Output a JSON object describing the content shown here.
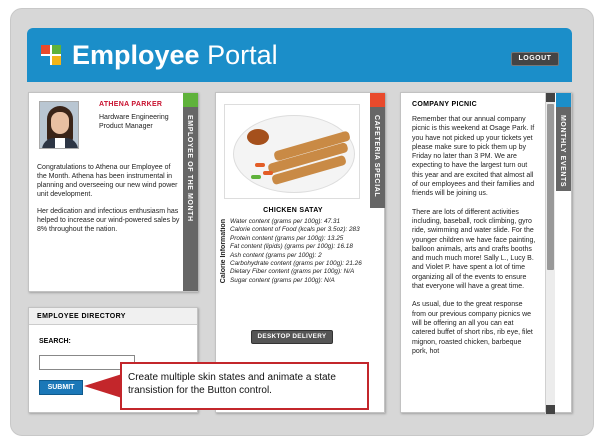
{
  "header": {
    "title_bold": "Employee",
    "title_rest": " Portal",
    "logout_label": "LOGOUT"
  },
  "employee_of_month": {
    "name": "ATHENA PARKER",
    "role": "Hardware Engineering Product Manager",
    "paragraphs": [
      "Congratulations to Athena our Employee of the Month. Athena has been instrumental in planning and overseeing our new wind power unit development.",
      "Her dedication and infectious enthusiasm has helped to increase our wind-powered sales by 8% throughout the nation."
    ],
    "tab_label": "EMPLOYEE OF THE MONTH",
    "accent": "#5fb23b"
  },
  "directory": {
    "title": "EMPLOYEE DIRECTORY",
    "search_label": "SEARCH:",
    "search_value": "",
    "submit_label": "SUBMIT"
  },
  "cafeteria": {
    "tab_label": "CAFETERIA SPECIAL",
    "accent": "#e94a2c",
    "dish_name": "CHICKEN SATAY",
    "info_label": "Calorie Information",
    "nutrition": [
      "Water content (grams per 100g): 47.31",
      "Calorie content of Food (kcals per 3.5oz): 283",
      "Protein content (grams per 100g): 13.25",
      "Fat content (lipids) (grams per 100g): 16.18",
      "Ash content (grams per 100g): 2",
      "Carbohydrate content (grams per 100g): 21.26",
      "Dietary Fiber content (grams per 100g): N/A",
      "Sugar content (grams per 100g): N/A"
    ],
    "delivery_label": "DESKTOP DELIVERY"
  },
  "events": {
    "tab_label": "MONTHLY EVENTS",
    "accent": "#1b8ec9",
    "title": "COMPANY PICNIC",
    "paragraphs": [
      "Remember that our annual company picnic is this weekend at Osage Park. If you have not picked up your tickets yet please make sure to pick them up by Friday no later than 3 PM. We are expecting to have the largest turn out this year and are excited that almost all of our employees and their families and friends will be joining us.",
      "There are lots of different activities including, baseball, rock climbing, gyro ride, swimming and water slide. For the younger children we have face painting, balloon animals, arts and crafts booths and much much more! Sally L., Lucy B. and Violet P. have spent a lot of time organizing all of the events to ensure that everyone will have a great time.",
      "As usual, due to the great response from our previous company picnics we will be offering an all you can eat catered buffet of short ribs, rib eye, filet mignon, roasted chicken, barbeque pork, hot"
    ]
  },
  "callout": {
    "text": "Create multiple skin states and animate a state transistion for the Button control."
  },
  "colors": {
    "header_blue": "#1b8ec9",
    "callout_red": "#c3262b",
    "name_red": "#c8102e"
  }
}
